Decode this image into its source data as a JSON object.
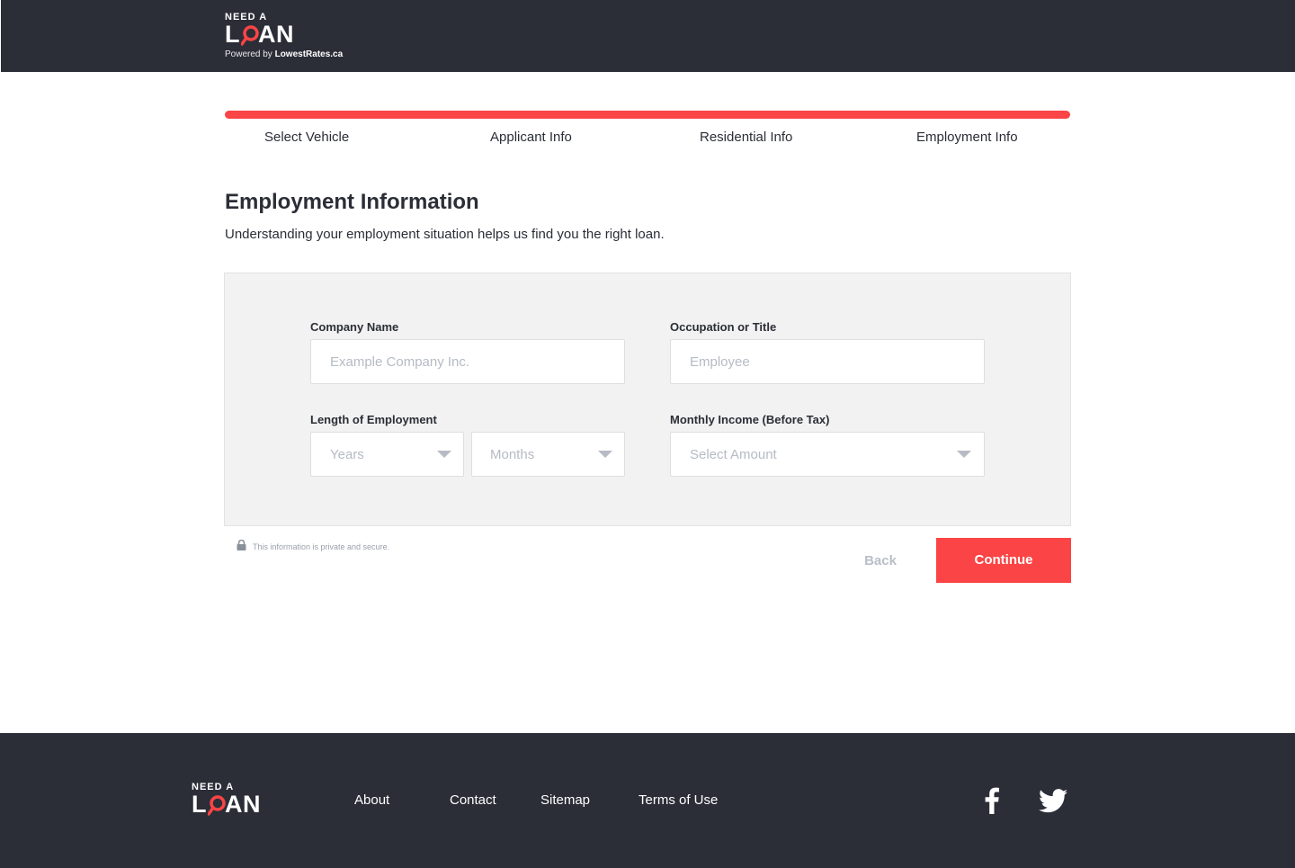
{
  "header": {
    "logo_need": "NEED A",
    "logo_l": "L",
    "logo_an": "AN",
    "powered_prefix": "Powered by ",
    "powered_brand": "LowestRates.ca"
  },
  "progress": {
    "steps": [
      "Select Vehicle",
      "Applicant Info",
      "Residential Info",
      "Employment Info"
    ],
    "completed_fraction": 1.0
  },
  "page": {
    "title": "Employment Information",
    "subtitle": "Understanding your employment situation helps us find you the right loan."
  },
  "form": {
    "company": {
      "label": "Company Name",
      "placeholder": "Example Company Inc."
    },
    "occupation": {
      "label": "Occupation or Title",
      "placeholder": "Employee"
    },
    "length": {
      "label": "Length of Employment",
      "years_placeholder": "Years",
      "months_placeholder": "Months"
    },
    "income": {
      "label": "Monthly Income (Before Tax)",
      "placeholder": "Select Amount"
    }
  },
  "actions": {
    "secure_text": "This information is private and secure.",
    "back_label": "Back",
    "continue_label": "Continue"
  },
  "footer": {
    "logo_need": "NEED A",
    "logo_l": "L",
    "logo_an": "AN",
    "links": [
      "About",
      "Contact",
      "Sitemap",
      "Terms of Use"
    ],
    "social": [
      "facebook-icon",
      "twitter-icon"
    ]
  },
  "colors": {
    "accent": "#fb4445",
    "dark": "#2b2e37",
    "panel": "#f2f2f2",
    "placeholder": "#b6bbc4"
  }
}
